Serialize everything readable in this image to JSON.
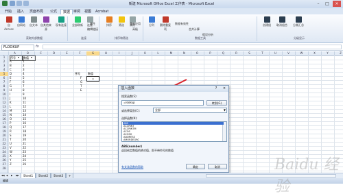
{
  "window": {
    "title": "新建 Microsoft Office Excel 工作表 - Microsoft Excel"
  },
  "ribbon_tabs": [
    "开始",
    "插入",
    "页面布局",
    "公式",
    "数据",
    "审阅",
    "视图",
    "Acrobat"
  ],
  "ribbon_active_tab": "数据",
  "ribbon": {
    "groups": [
      "获取外部数据",
      "连接",
      "排序和筛选",
      "数据工具",
      "分级显示"
    ],
    "buttons": [
      "自 Access",
      "自网站",
      "自文本",
      "自其他来源",
      "现有连接",
      "全部刷新",
      "连接",
      "属性",
      "编辑链接",
      "排序",
      "筛选",
      "清除",
      "重新应用",
      "高级",
      "分列",
      "删除重复项",
      "数据有效性",
      "合并计算",
      "假设分析",
      "创建组",
      "取消组合",
      "分类汇总"
    ]
  },
  "formula_bar": {
    "name_box": "FLOOKUP",
    "fx": "fx",
    "content": ""
  },
  "columns": [
    "A",
    "B",
    "C",
    "D",
    "E",
    "F",
    "G",
    "H",
    "I",
    "J",
    "K",
    "L",
    "M",
    "N",
    "O",
    "P",
    "Q",
    "R",
    "S",
    "T",
    "U",
    "V",
    "W",
    "X",
    "Y",
    "Z"
  ],
  "selected_column": "G",
  "rows": [
    "1",
    "2",
    "3",
    "4",
    "5",
    "6",
    "7",
    "8",
    "9",
    "10",
    "11",
    "12",
    "13",
    "14",
    "15",
    "16",
    "17",
    "18",
    "19",
    "20",
    "21",
    "22",
    "23",
    "24",
    "25",
    "26",
    "27",
    "28"
  ],
  "selected_row": "5",
  "table_headers": {
    "A": "序号",
    "B": "数值"
  },
  "table_letters": [
    "A",
    "B",
    "C",
    "D",
    "E",
    "F",
    "G",
    "H",
    "I",
    "J",
    "K",
    "L",
    "M",
    "N",
    "O",
    "P",
    "Q",
    "R",
    "S",
    "T",
    "U",
    "V",
    "W",
    "X",
    "Y",
    "Z"
  ],
  "table_numbers": [
    "1",
    "2",
    "3",
    "4",
    "5",
    "6",
    "7",
    "8",
    "9",
    "10",
    "11",
    "12",
    "13",
    "14",
    "15",
    "16",
    "17",
    "18",
    "19",
    "20",
    "21",
    "22",
    "23",
    "24",
    "25",
    "26"
  ],
  "side_headers": {
    "F": "序号",
    "G": "数值"
  },
  "side_letters": [
    "F",
    "G",
    "T",
    "E"
  ],
  "active_cell_value": "=",
  "dialog": {
    "title": "插入函数",
    "help": "?",
    "close": "×",
    "search_label": "搜索函数(S):",
    "search_value": "=lookup",
    "go_button": "转到(G)",
    "category_label": "或选择类别(C):",
    "category_value": "全部",
    "select_label": "选择函数(N):",
    "functions": [
      "ABS",
      "ACCRINT",
      "ACCRINTM",
      "ACOS",
      "ACOSH",
      "ADDRESS",
      "AMORDEGRC"
    ],
    "selected_function": "ABS",
    "signature": "ABS(number)",
    "description": "返回给定数值的绝对值，即不带符号的数值",
    "help_link": "有关该函数的帮助",
    "ok": "确定",
    "cancel": "取消"
  },
  "sheet_tabs": [
    "Sheet1",
    "Sheet2",
    "Sheet3"
  ],
  "status": "编辑",
  "watermark": "Baidu 经验"
}
